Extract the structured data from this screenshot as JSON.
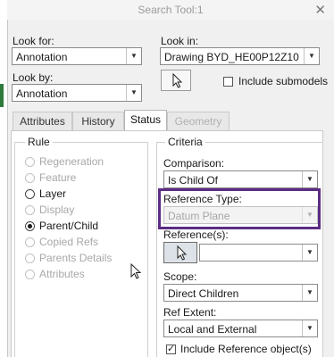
{
  "window": {
    "title": "Search Tool:1"
  },
  "look_for": {
    "label": "Look for:",
    "value": "Annotation"
  },
  "look_by": {
    "label": "Look by:",
    "value": "Annotation"
  },
  "look_in": {
    "label": "Look in:",
    "value": "Drawing BYD_HE00P12Z108-2D_",
    "include_submodels": "Include submodels"
  },
  "tabs": [
    {
      "label": "Attributes"
    },
    {
      "label": "History"
    },
    {
      "label": "Status"
    },
    {
      "label": "Geometry"
    }
  ],
  "rule": {
    "title": "Rule",
    "options": [
      {
        "label": "Regeneration"
      },
      {
        "label": "Feature"
      },
      {
        "label": "Layer"
      },
      {
        "label": "Display"
      },
      {
        "label": "Parent/Child"
      },
      {
        "label": "Copied Refs"
      },
      {
        "label": "Parents Details"
      },
      {
        "label": "Attributes"
      }
    ],
    "selected": "Parent/Child"
  },
  "criteria": {
    "title": "Criteria",
    "comparison": {
      "label": "Comparison:",
      "value": "Is Child Of"
    },
    "reference_type": {
      "label": "Reference Type:",
      "value": "Datum Plane"
    },
    "references": {
      "label": "Reference(s):",
      "value": ""
    },
    "scope": {
      "label": "Scope:",
      "value": "Direct Children"
    },
    "ref_extent": {
      "label": "Ref Extent:",
      "value": "Local and External"
    },
    "include_reference": {
      "label": "Include Reference object(s)",
      "checked": true
    }
  },
  "colors": {
    "highlight": "#5b2c83"
  }
}
